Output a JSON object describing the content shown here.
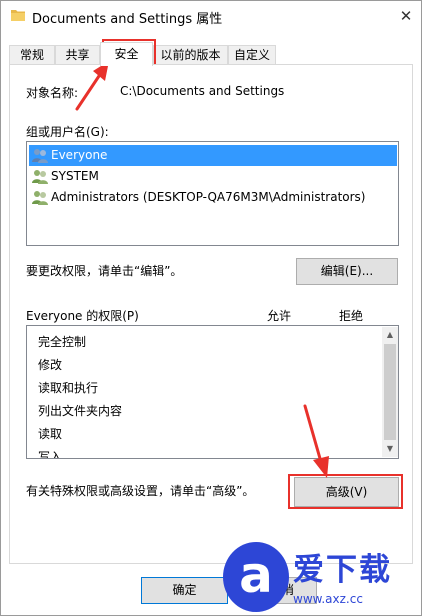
{
  "window": {
    "title": "Documents and Settings 属性",
    "close_glyph": "✕"
  },
  "tabs": [
    {
      "label": "常规",
      "active": false
    },
    {
      "label": "共享",
      "active": false
    },
    {
      "label": "安全",
      "active": true
    },
    {
      "label": "以前的版本",
      "active": false
    },
    {
      "label": "自定义",
      "active": false
    }
  ],
  "security": {
    "object_name_label": "对象名称:",
    "object_name_value": "C:\\Documents and Settings",
    "group_label": "组或用户名(G):",
    "users": [
      {
        "name": "Everyone",
        "selected": true
      },
      {
        "name": "SYSTEM",
        "selected": false
      },
      {
        "name": "Administrators (DESKTOP-QA76M3M\\Administrators)",
        "selected": false
      }
    ],
    "edit_hint": "要更改权限，请单击“编辑”。",
    "edit_button": "编辑(E)...",
    "permissions_label": "Everyone 的权限(P)",
    "allow_header": "允许",
    "deny_header": "拒绝",
    "permissions": [
      "完全控制",
      "修改",
      "读取和执行",
      "列出文件夹内容",
      "读取",
      "写入"
    ],
    "advanced_hint": "有关特殊权限或高级设置，请单击“高级”。",
    "advanced_button": "高级(V)"
  },
  "footer": {
    "ok_button": "确定",
    "cancel_button": "消"
  },
  "watermark": {
    "logo_letter": "a",
    "title": "爱下载",
    "url": "www.axz.cc"
  },
  "colors": {
    "selection": "#3399ff",
    "highlight_red": "#e8312b",
    "watermark_blue": "#2d46d6"
  }
}
